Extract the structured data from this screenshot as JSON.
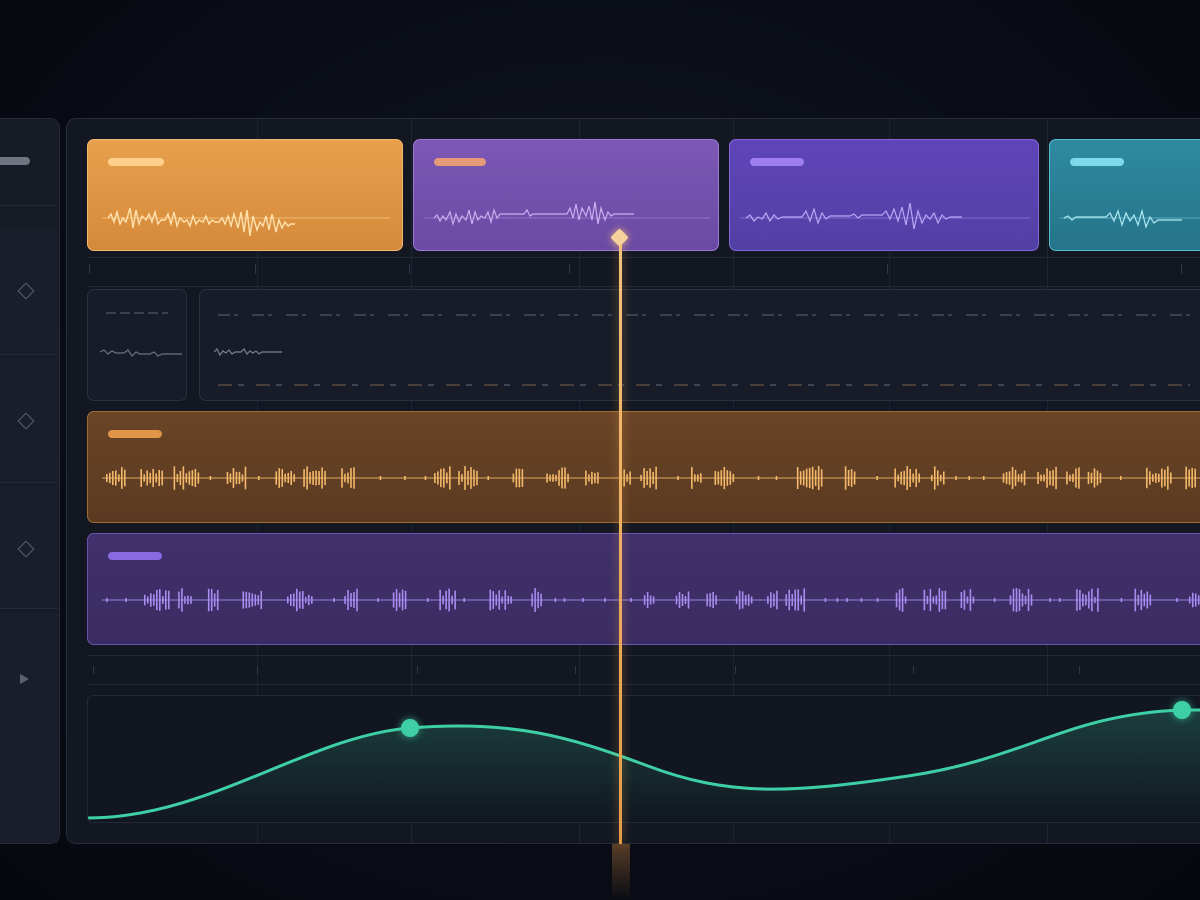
{
  "colors": {
    "orange": "#e9a04e",
    "purple": "#7d5cc4",
    "violet": "#6b4fd0",
    "teal": "#3aa6b9",
    "automation": "#3fcfa5",
    "playhead": "#f2b66a"
  },
  "clips": [
    {
      "name": "clip-orange",
      "color": "#e9a04e"
    },
    {
      "name": "clip-purple",
      "color": "#8e68c8"
    },
    {
      "name": "clip-violet",
      "color": "#6b4fd0"
    },
    {
      "name": "clip-teal",
      "color": "#3aa6b9"
    }
  ],
  "rail": {
    "icons": [
      "diamond-icon",
      "diamond-icon",
      "diamond-icon",
      "play-icon"
    ]
  },
  "automation": {
    "points": [
      0.1,
      0.78,
      0.9
    ]
  },
  "playhead": {
    "position": 0.49
  }
}
